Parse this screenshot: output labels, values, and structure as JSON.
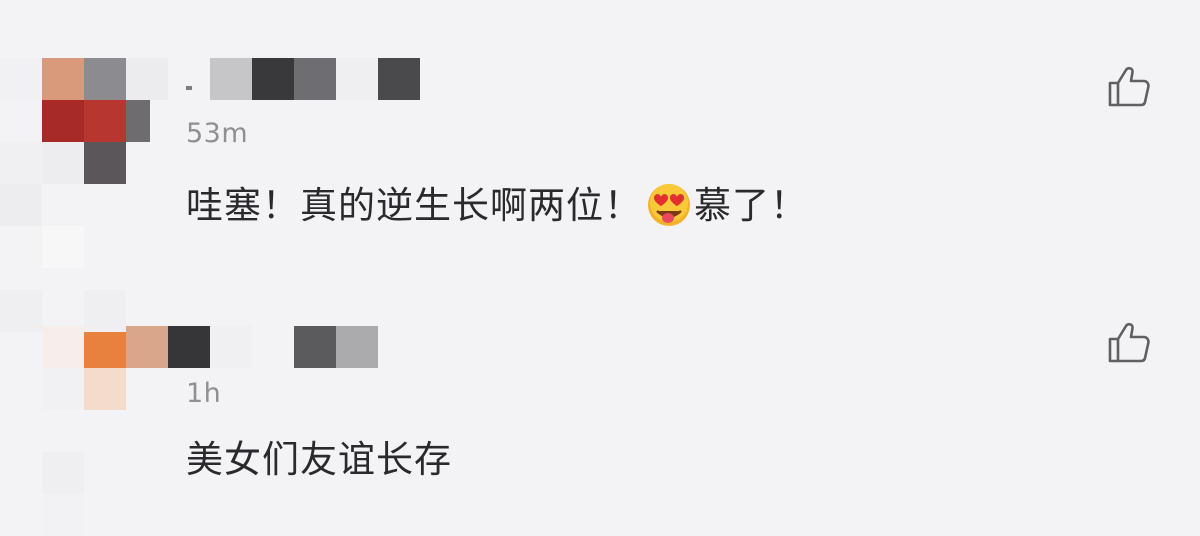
{
  "comments": [
    {
      "timestamp": "53m",
      "text_before_emoji": "哇塞！真的逆生长啊两位！",
      "emoji": "heart-eyes-tongue-emoji",
      "text_after_emoji": "慕了！",
      "like_icon": "thumbs-up-icon"
    },
    {
      "timestamp": "1h",
      "text": "美女们友谊长存",
      "like_icon": "thumbs-up-icon"
    }
  ]
}
